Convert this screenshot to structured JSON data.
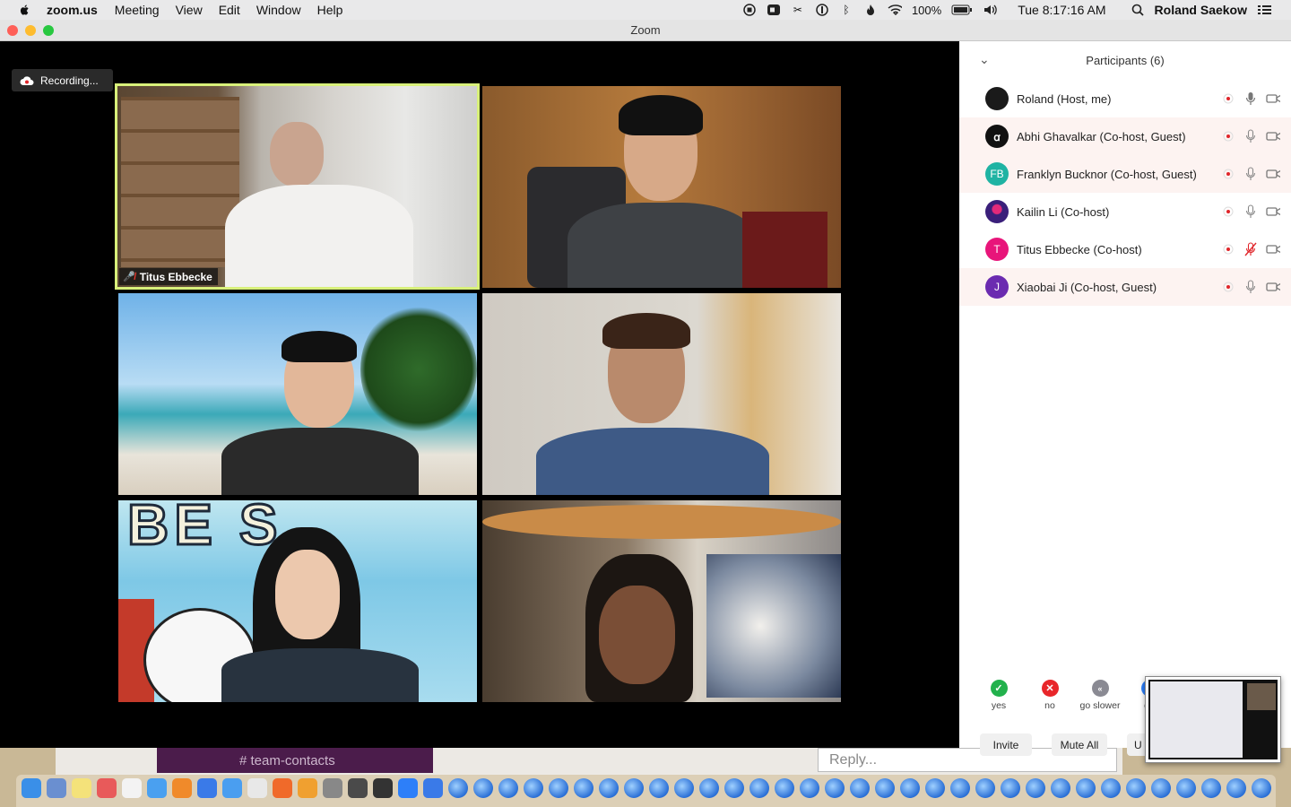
{
  "menubar": {
    "app_name": "zoom.us",
    "menus": [
      "Meeting",
      "View",
      "Edit",
      "Window",
      "Help"
    ],
    "battery": "100%",
    "clock": "Tue 8:17:16 AM",
    "user": "Roland Saekow"
  },
  "window": {
    "title": "Zoom"
  },
  "recording": {
    "label": "Recording..."
  },
  "tiles": {
    "active_name": "Titus Ebbecke"
  },
  "participants": {
    "title": "Participants (6)",
    "list": [
      {
        "name": "Roland (Host, me)",
        "initials": "",
        "color": "#1a1a1a"
      },
      {
        "name": "Abhi Ghavalkar (Co-host, Guest)",
        "initials": "ꭤ",
        "color": "#111111"
      },
      {
        "name": "Franklyn Bucknor (Co-host, Guest)",
        "initials": "FB",
        "color": "#1fb3a3"
      },
      {
        "name": "Kailin Li (Co-host)",
        "initials": "",
        "color": "#3a1f7a"
      },
      {
        "name": "Titus Ebbecke (Co-host)",
        "initials": "T",
        "color": "#e8157a"
      },
      {
        "name": "Xiaobai Ji (Co-host, Guest)",
        "initials": "J",
        "color": "#6b2bb0"
      }
    ]
  },
  "feedback": {
    "yes": "yes",
    "no": "no",
    "slower": "go slower",
    "faster": "go"
  },
  "buttons": {
    "invite": "Invite",
    "mute_all": "Mute All",
    "more": "U"
  },
  "background": {
    "channel": "# team-contacts",
    "reply_placeholder": "Reply..."
  }
}
